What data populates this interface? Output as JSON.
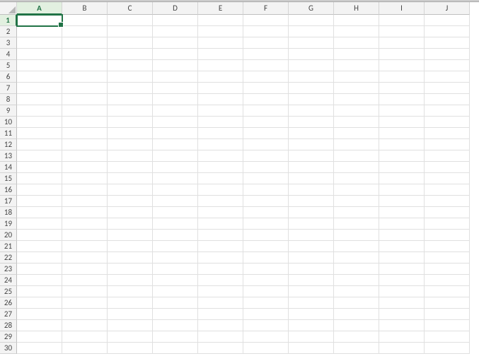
{
  "accent_color": "#217346",
  "columns": [
    "A",
    "B",
    "C",
    "D",
    "E",
    "F",
    "G",
    "H",
    "I",
    "J"
  ],
  "row_count": 30,
  "active_cell": {
    "col": "A",
    "row": 1
  },
  "cells": {}
}
